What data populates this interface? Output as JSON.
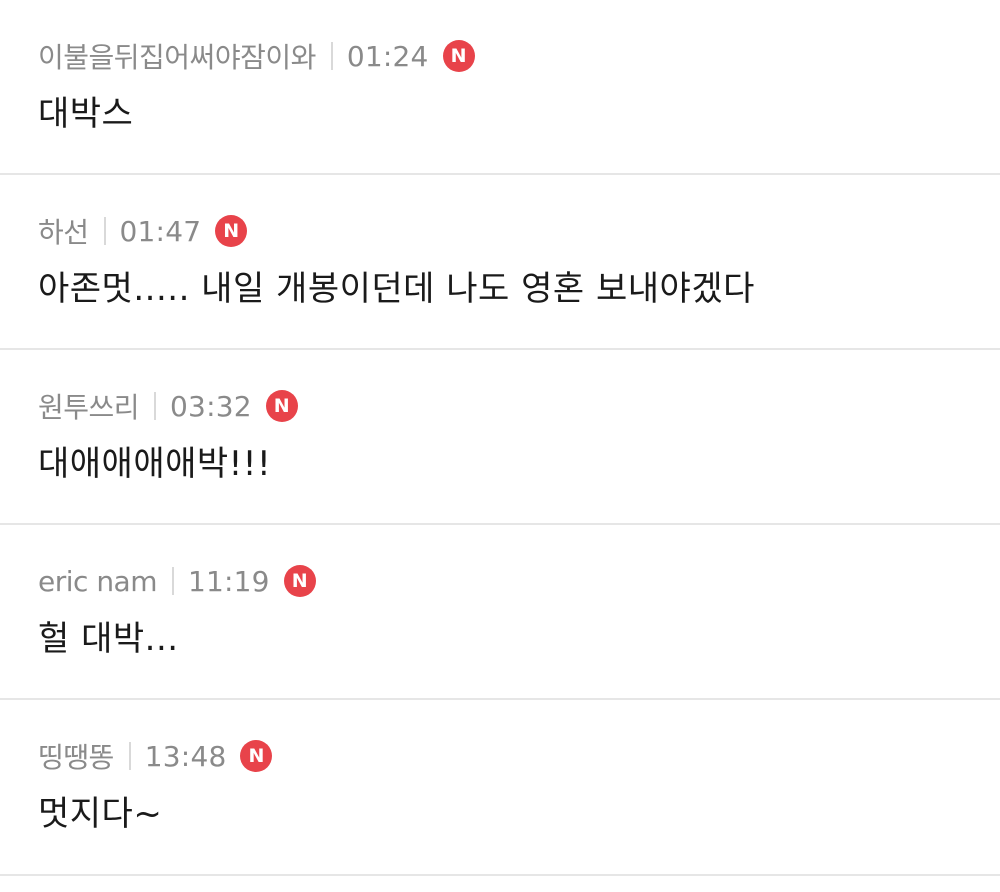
{
  "comments": [
    {
      "author": "이불을뒤집어써야잠이와",
      "time": "01:24",
      "badge": "N",
      "text": "대박스"
    },
    {
      "author": "하선",
      "time": "01:47",
      "badge": "N",
      "text": "아존멋..... 내일 개봉이던데 나도 영혼 보내야겠다"
    },
    {
      "author": "원투쓰리",
      "time": "03:32",
      "badge": "N",
      "text": "대애애애애박!!!"
    },
    {
      "author": "eric nam",
      "time": "11:19",
      "badge": "N",
      "text": "헐 대박..."
    },
    {
      "author": "띵땡똥",
      "time": "13:48",
      "badge": "N",
      "text": "멋지다~"
    }
  ],
  "colors": {
    "badge": "#e8434a",
    "meta_text": "#8a8a8a",
    "body_text": "#1a1a1a",
    "divider": "#e6e6e6"
  }
}
